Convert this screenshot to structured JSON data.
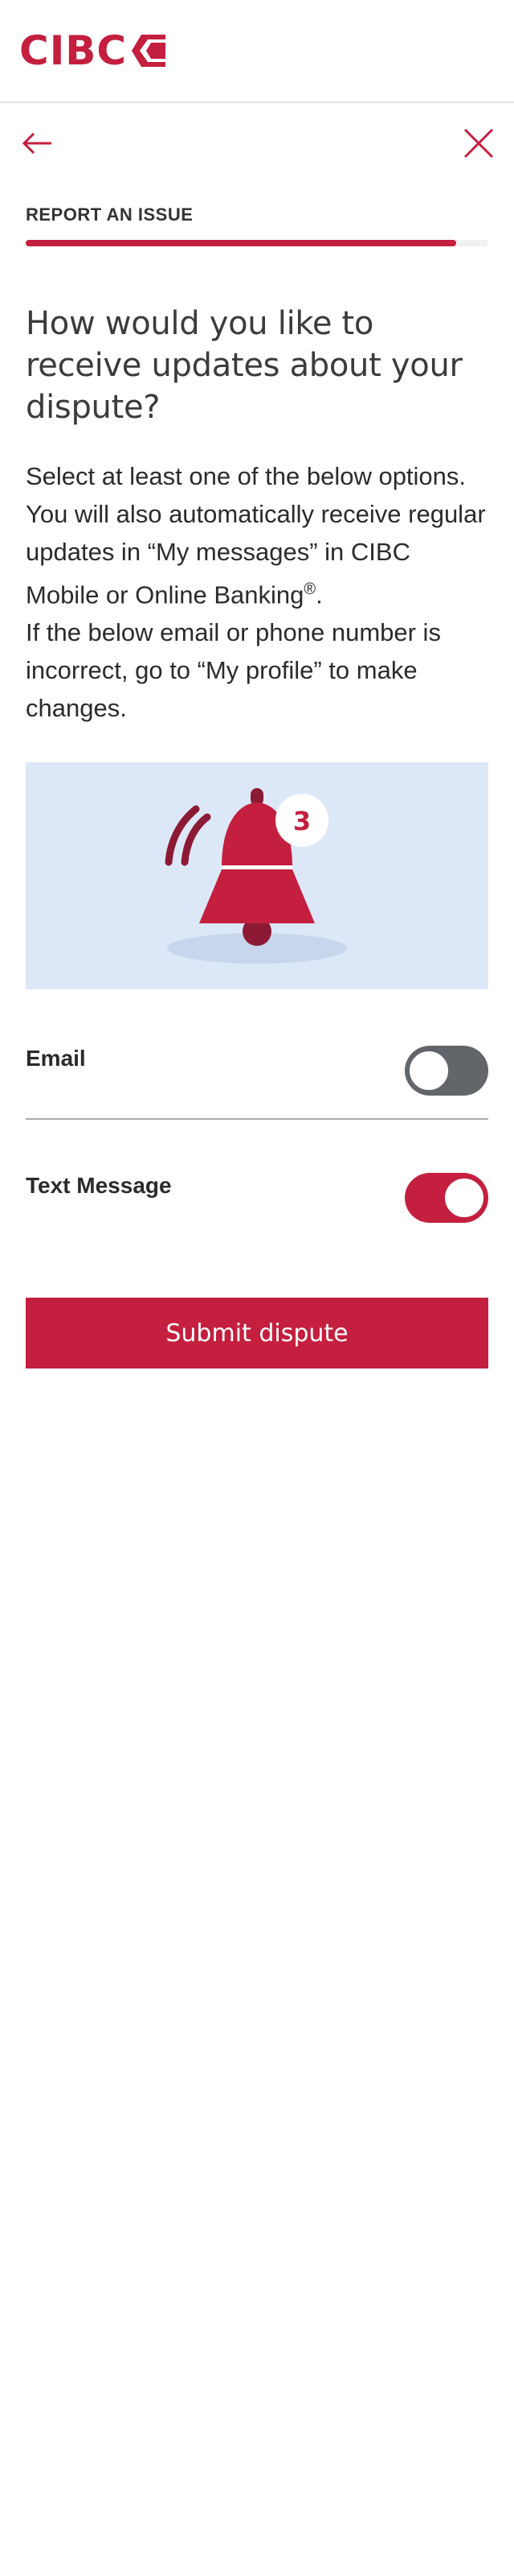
{
  "brand": {
    "name": "CIBC",
    "color": "#c41f3e"
  },
  "nav": {
    "back_icon": "arrow-left-icon",
    "close_icon": "close-icon"
  },
  "step": {
    "label": "REPORT AN ISSUE",
    "progress": 0.93
  },
  "question": "How would you like to receive updates about your dispute?",
  "body": {
    "line1": "Select at least one of the below options. You will also automatically receive regular updates in “My messages” in CIBC Mobile or Online Banking",
    "registered": "®",
    "line1_end": ".",
    "line2": "If the below email or phone number is incorrect, go to “My profile” to make changes."
  },
  "illustration": {
    "icon": "notification-bell-icon",
    "badge_count": "3"
  },
  "options": [
    {
      "label": "Email",
      "enabled": false
    },
    {
      "label": "Text Message",
      "enabled": true
    }
  ],
  "submit_label": "Submit dispute"
}
